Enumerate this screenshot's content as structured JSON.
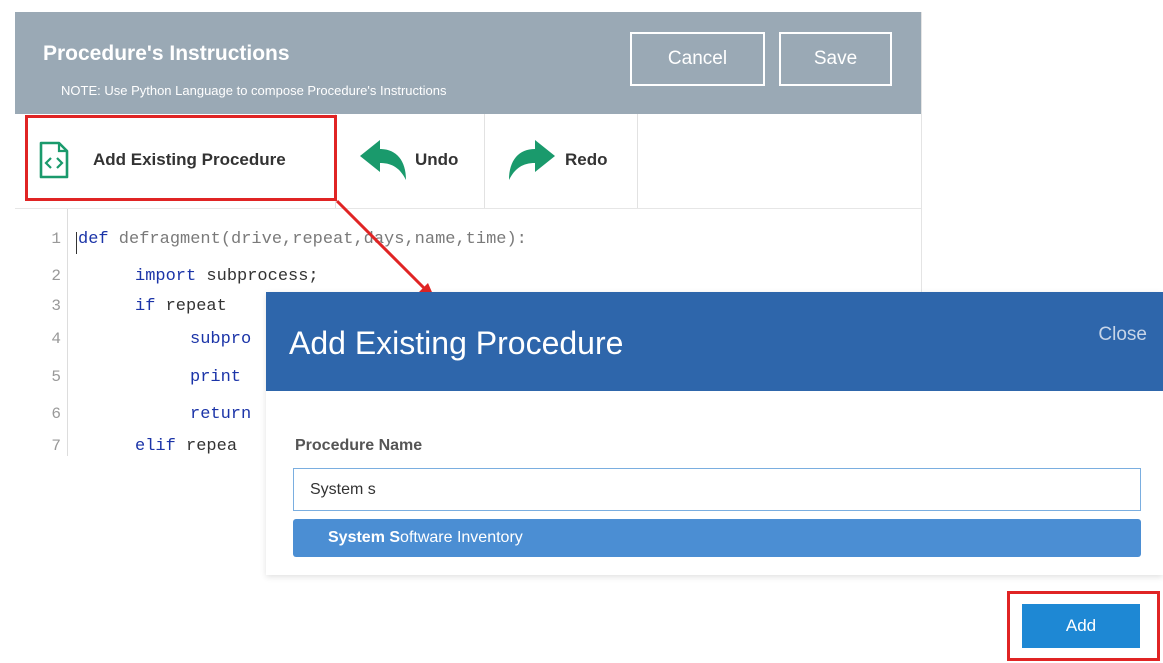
{
  "editor": {
    "title": "Procedure's Instructions",
    "note": "NOTE: Use Python Language to compose Procedure's Instructions",
    "cancel_label": "Cancel",
    "save_label": "Save"
  },
  "toolbar": {
    "add_existing_label": "Add Existing Procedure",
    "add_existing_icon": "code-file-icon",
    "undo_label": "Undo",
    "undo_icon": "undo-arrow-icon",
    "redo_label": "Redo",
    "redo_icon": "redo-arrow-icon"
  },
  "code": {
    "line_numbers": [
      "1",
      "2",
      "3",
      "4",
      "5",
      "6",
      "7"
    ],
    "lines": [
      {
        "kw": "def",
        "rest": " defragment(drive,repeat,days,name,time):"
      },
      {
        "kw": "import",
        "rest": " subprocess;"
      },
      {
        "kw": "if",
        "rest": " repeat"
      },
      {
        "kw": "",
        "rest": "subpro"
      },
      {
        "kw": "print",
        "rest": ""
      },
      {
        "kw": "return",
        "rest": ""
      },
      {
        "kw": "elif",
        "rest": " repea"
      }
    ]
  },
  "dialog": {
    "title": "Add Existing Procedure",
    "close_label": "Close",
    "field_label": "Procedure Name",
    "input_value": "System s",
    "suggestion_bold_1": "System S",
    "suggestion_rest": "oftware Inventory",
    "add_label": "Add"
  },
  "colors": {
    "editor_header": "#9aa9b5",
    "dialog_header": "#2e66ab",
    "suggestion": "#4b8ed3",
    "add_button": "#1e88d4",
    "highlight": "#e02424",
    "icon_green": "#1a9a6c"
  }
}
